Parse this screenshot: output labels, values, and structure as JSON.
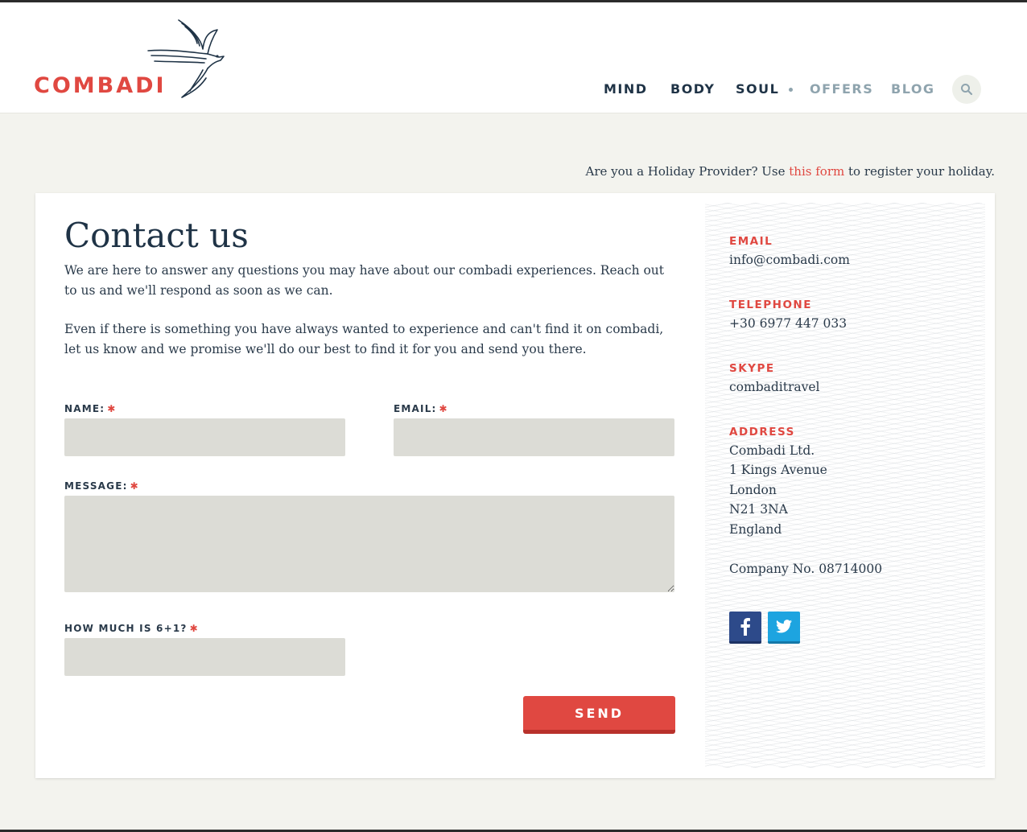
{
  "brand": {
    "name": "COMBADI",
    "accent": "#e04841",
    "navy": "#1f3346"
  },
  "nav": {
    "items": [
      {
        "label": "MIND"
      },
      {
        "label": "BODY"
      },
      {
        "label": "SOUL"
      },
      {
        "label": "OFFERS"
      },
      {
        "label": "BLOG"
      }
    ],
    "search_icon": "search-icon"
  },
  "provider_note": {
    "prefix": "Are you a Holiday Provider? Use ",
    "link": "this form",
    "suffix": " to register your holiday."
  },
  "contact": {
    "title": "Contact us",
    "intro_1": "We are here to answer any questions you may have about our combadi experiences. Reach out to us and we'll respond as soon as we can.",
    "intro_2": "Even if there is something you have always wanted to experience and can't find it on combadi, let us know and we promise we'll do our best to find it for you and send you there."
  },
  "form": {
    "name_label": "NAME:",
    "email_label": "EMAIL:",
    "message_label": "MESSAGE:",
    "captcha_label": "HOW MUCH IS 6+1?",
    "required_mark": "✱",
    "name_value": "",
    "email_value": "",
    "message_value": "",
    "captcha_value": "",
    "send_label": "SEND"
  },
  "sidebar": {
    "email_label": "EMAIL",
    "email_value": "info@combadi.com",
    "telephone_label": "TELEPHONE",
    "telephone_value": "+30 6977 447 033",
    "skype_label": "SKYPE",
    "skype_value": "combaditravel",
    "address_label": "ADDRESS",
    "address_lines": [
      "Combadi Ltd.",
      "1 Kings Avenue",
      "London",
      "N21 3NA",
      "England"
    ],
    "company_no": "Company No. 08714000",
    "social": [
      {
        "glyph": "f",
        "icon": "facebook-icon",
        "color": "#2d4a8a"
      },
      {
        "glyph": "t",
        "icon": "twitter-icon",
        "color": "#1da4e0"
      }
    ]
  }
}
